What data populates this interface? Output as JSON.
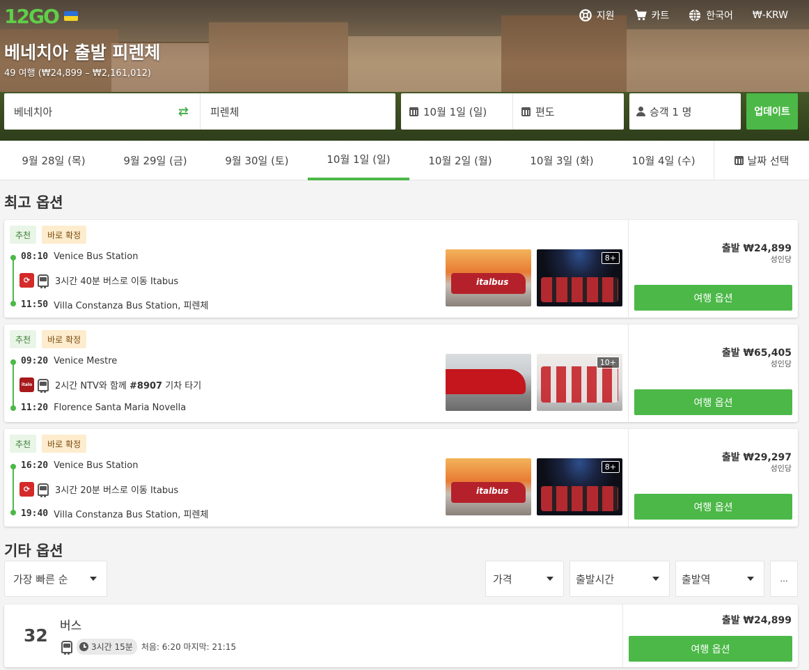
{
  "header": {
    "logo": "12GO",
    "nav": [
      {
        "icon": "lifebuoy-icon",
        "label": "지원"
      },
      {
        "icon": "cart-icon",
        "label": "카트"
      },
      {
        "icon": "globe-icon",
        "label": "한국어"
      },
      {
        "icon": "currency-icon",
        "label": "₩-KRW"
      }
    ],
    "title": "베네치아 출발 피렌체",
    "subtitle": "49 여행 (₩24,899 – ₩2,161,012)"
  },
  "search": {
    "from": "베네치아",
    "to": "피렌체",
    "date": "10월 1일 (일)",
    "return": "편도",
    "passengers": "승객 1 명",
    "update_label": "업데이트"
  },
  "date_tabs": [
    {
      "label": "9월 28일 (목)",
      "active": false
    },
    {
      "label": "9월 29일 (금)",
      "active": false
    },
    {
      "label": "9월 30일 (토)",
      "active": false
    },
    {
      "label": "10월 1일 (일)",
      "active": true
    },
    {
      "label": "10월 2일 (월)",
      "active": false
    },
    {
      "label": "10월 3일 (화)",
      "active": false
    },
    {
      "label": "10월 4일 (수)",
      "active": false
    }
  ],
  "date_picker_label": "날짜 선택",
  "best": {
    "title": "최고 옵션",
    "badge_recommended": "추천",
    "badge_confirmed": "바로 확정",
    "per_person": "성인당",
    "button": "여행 옵션",
    "trips": [
      {
        "dep_time": "08:10",
        "dep_station": "Venice Bus Station",
        "operator_logo": "italbus",
        "mode_icon": "bus-icon",
        "desc": "3시간 40분 버스로 이동 Itabus",
        "arr_time": "11:50",
        "arr_station": "Villa Constanza Bus Station, 피렌체",
        "photos_extra": "8+",
        "price": "출발 ₩24,899"
      },
      {
        "dep_time": "09:20",
        "dep_station": "Venice Mestre",
        "operator_logo": "italo",
        "mode_icon": "train-icon",
        "desc_pre": "2시간 NTV와 함께 ",
        "desc_num": "#8907",
        "desc_post": " 기차 타기",
        "arr_time": "11:20",
        "arr_station": "Florence Santa Maria Novella",
        "photos_extra": "10+",
        "price": "출발 ₩65,405"
      },
      {
        "dep_time": "16:20",
        "dep_station": "Venice Bus Station",
        "operator_logo": "italbus",
        "mode_icon": "bus-icon",
        "desc": "3시간 20분 버스로 이동 Itabus",
        "arr_time": "19:40",
        "arr_station": "Villa Constanza Bus Station, 피렌체",
        "photos_extra": "8+",
        "price": "출발 ₩29,297"
      }
    ]
  },
  "other": {
    "title": "기타 옵션",
    "sort": "가장 빠른 순",
    "filters": [
      "가격",
      "출발시간",
      "출발역"
    ],
    "more": "...",
    "card": {
      "count": "32",
      "mode": "버스",
      "duration": "3시간 15분",
      "range": "처음: 6:20 마지막: 21:15",
      "price": "출발 ₩24,899",
      "button": "여행 옵션"
    }
  },
  "colors": {
    "accent": "#4cb848",
    "badge_rec_bg": "#e9f5e7",
    "badge_conf_bg": "#fdeccd"
  }
}
